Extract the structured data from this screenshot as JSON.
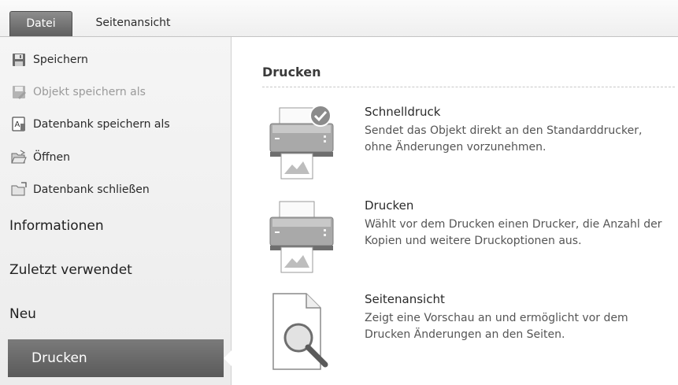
{
  "tabs": {
    "datei": "Datei",
    "seitenansicht": "Seitenansicht"
  },
  "commands": [
    {
      "label": "Speichern",
      "icon": "save-icon",
      "enabled": true
    },
    {
      "label": "Objekt speichern als",
      "icon": "save-object-as-icon",
      "enabled": false
    },
    {
      "label": "Datenbank speichern als",
      "icon": "database-save-as-icon",
      "enabled": true
    },
    {
      "label": "Öffnen",
      "icon": "open-folder-icon",
      "enabled": true
    },
    {
      "label": "Datenbank schließen",
      "icon": "close-database-icon",
      "enabled": true
    }
  ],
  "nav": {
    "informationen": "Informationen",
    "zuletzt": "Zuletzt verwendet",
    "neu": "Neu",
    "drucken": "Drucken"
  },
  "content": {
    "title": "Drucken",
    "options": [
      {
        "title": "Schnelldruck",
        "description": "Sendet das Objekt direkt an den Standarddrucker, ohne Änderungen vorzunehmen.",
        "icon": "quick-print-icon"
      },
      {
        "title": "Drucken",
        "description": "Wählt vor dem Drucken einen Drucker, die Anzahl der Kopien und weitere Druckoptionen aus.",
        "icon": "printer-icon"
      },
      {
        "title": "Seitenansicht",
        "description": "Zeigt eine Vorschau an und ermöglicht vor dem Drucken Änderungen an den Seiten.",
        "icon": "print-preview-icon"
      }
    ]
  }
}
